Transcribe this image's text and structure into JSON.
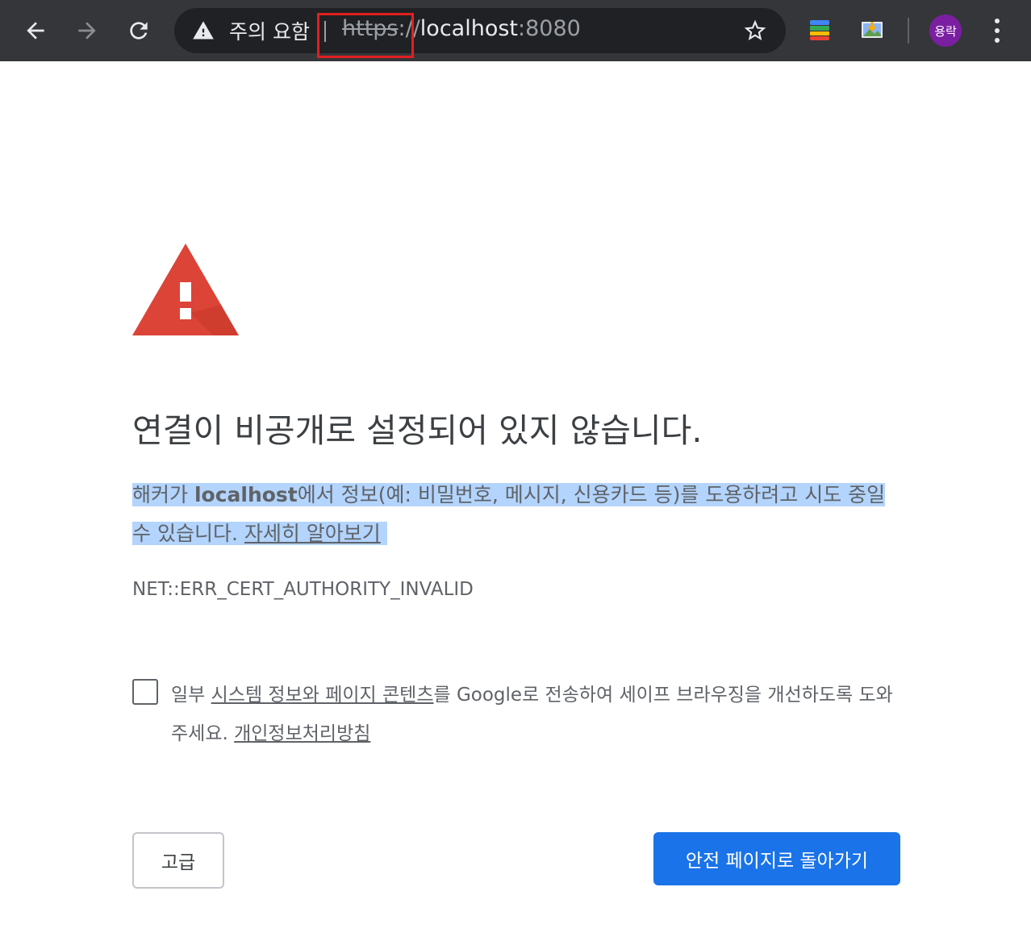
{
  "browser": {
    "security_label": "주의 요함",
    "url_scheme": "https",
    "url_separator": "://",
    "url_host": "localhost",
    "url_port": ":8080",
    "avatar_label": "용락",
    "icons": {
      "back": "arrow-left-icon",
      "forward": "arrow-right-icon",
      "reload": "reload-icon",
      "security": "warning-triangle-icon",
      "bookmark": "star-icon",
      "extension_1": "colorful-stack-icon",
      "extension_2": "image-download-icon",
      "menu": "kebab-menu-icon"
    }
  },
  "interstitial": {
    "heading": "연결이 비공개로 설정되어 있지 않습니다.",
    "explanation_prefix": "해커가 ",
    "explanation_host": "localhost",
    "explanation_suffix": "에서 정보(예: 비밀번호, 메시지, 신용카드 등)를 도용하려고 시도 중일 수 있습니다.",
    "learn_more": "자세히 알아보기",
    "error_code": "NET::ERR_CERT_AUTHORITY_INVALID",
    "optin_prefix": "일부 ",
    "optin_link": "시스템 정보와 페이지 콘텐츠",
    "optin_suffix": "를 Google로 전송하여 세이프 브라우징을 개선하도록 도와주세요.",
    "privacy_link": "개인정보처리방침",
    "advanced_button": "고급",
    "back_button": "안전 페이지로 돌아가기",
    "optin_checked": false
  },
  "colors": {
    "toolbar_bg": "#35363a",
    "omnibox_bg": "#202124",
    "warning_red": "#db4437",
    "primary_blue": "#1a73e8",
    "highlight_box": "#e02020",
    "selection": "#b3d4fc",
    "avatar_bg": "#7b1fa2"
  }
}
